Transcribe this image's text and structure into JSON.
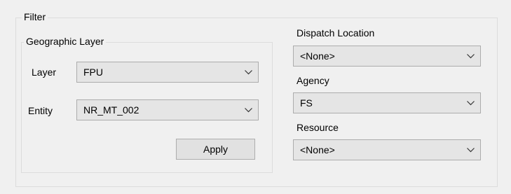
{
  "filter": {
    "title": "Filter",
    "geographic_layer": {
      "title": "Geographic Layer",
      "layer": {
        "label": "Layer",
        "value": "FPU"
      },
      "entity": {
        "label": "Entity",
        "value": "NR_MT_002"
      },
      "apply_label": "Apply"
    },
    "dispatch_location": {
      "label": "Dispatch Location",
      "value": "<None>"
    },
    "agency": {
      "label": "Agency",
      "value": "FS"
    },
    "resource": {
      "label": "Resource",
      "value": "<None>"
    }
  },
  "icons": {
    "dropdown": "chevron-down-icon"
  }
}
